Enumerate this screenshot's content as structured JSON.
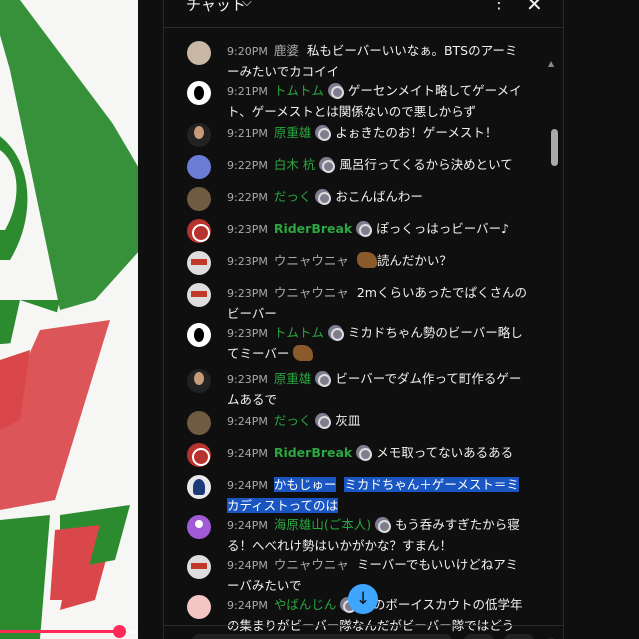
{
  "chat": {
    "title": "チャット",
    "chevron": "⌵",
    "more": "⋮",
    "close": "✕",
    "jump_icon": "↓",
    "messages": [
      {
        "time": "9:20PM",
        "author": "鹿婆",
        "text": "私もビーバーいいなぁ。BTSのアーミーみたいでカコイイ",
        "avatar": "av-gray"
      },
      {
        "time": "9:21PM",
        "author": "トムトム",
        "text": "ゲーセンメイト略してゲーメイト、ゲーメストとは関係ないので悪しからず",
        "avatar": "av-cat"
      },
      {
        "time": "9:21PM",
        "author": "原重雄",
        "text": "よぉきたのお！ゲーメスト！",
        "avatar": "av-man"
      },
      {
        "time": "9:22PM",
        "author": "白木 杭",
        "text": "風呂行ってくるから決めといて",
        "avatar": "av-blue"
      },
      {
        "time": "9:22PM",
        "author": "だっく",
        "text": "おこんばんわー",
        "avatar": "av-bird"
      },
      {
        "time": "9:23PM",
        "author": "RiderBreak",
        "text": "ぽっくっはっビーバー♪",
        "avatar": "av-red"
      },
      {
        "time": "9:23PM",
        "author": "ウニャウニャ",
        "text": "読んだかい？",
        "avatar": "av-doll"
      },
      {
        "time": "9:23PM",
        "author": "ウニャウニャ",
        "text": "2mくらいあったでぱくさんのビーバー",
        "avatar": "av-doll"
      },
      {
        "time": "9:23PM",
        "author": "トムトム",
        "text": "ミカドちゃん勢のビーバー略してミーバー",
        "avatar": "av-cat"
      },
      {
        "time": "9:23PM",
        "author": "原重雄",
        "text": "ビーバーでダム作って町作るゲームあるで",
        "avatar": "av-man"
      },
      {
        "time": "9:24PM",
        "author": "だっく",
        "text": "灰皿",
        "avatar": "av-bird"
      },
      {
        "time": "9:24PM",
        "author": "RiderBreak",
        "text": "メモ取ってないあるある",
        "avatar": "av-red"
      },
      {
        "time": "9:24PM",
        "author": "かもじゅー",
        "text": "ミカドちゃん＋ゲーメスト＝ミカディストってのは",
        "avatar": "av-person"
      },
      {
        "time": "9:24PM",
        "author": "海原雄山(ご本人)",
        "text": "もう呑みすぎたから寝る！へべれけ勢はいかがかな？すまん！",
        "avatar": "av-purple"
      },
      {
        "time": "9:24PM",
        "author": "ウニャウニャ",
        "text": "ミーバーでもいいけどねアミーバみたいで",
        "avatar": "av-doll"
      },
      {
        "time": "9:24PM",
        "author": "やばんじん",
        "text": "元のボーイスカウトの低学年の集まりがビーバー隊なんだがビーバー隊ではどう",
        "avatar": "av-pink"
      }
    ]
  },
  "video": {
    "progress": 0.94
  },
  "colors": {
    "background": "#0f0f0f",
    "author_member": "#2ba640",
    "highlight": "#1a56c2",
    "jump_button": "#3ea6ff",
    "progress": "#ff2a56"
  }
}
